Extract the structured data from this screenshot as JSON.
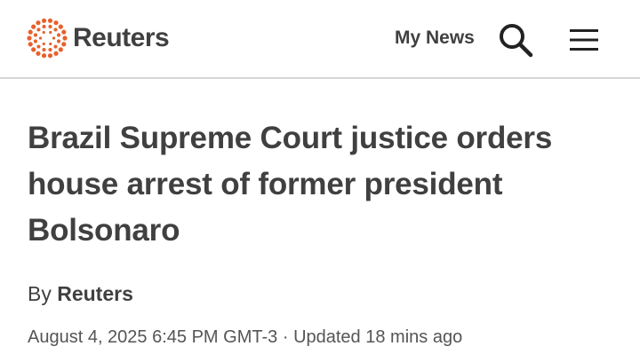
{
  "colors": {
    "brand_orange": "#e8602c",
    "text": "#404040",
    "divider": "#d6d6d6"
  },
  "header": {
    "logo_icon": "reuters-dots-logo-icon",
    "logo_text": "Reuters",
    "my_news_label": "My News",
    "search_icon": "search-icon",
    "menu_icon": "hamburger-menu-icon"
  },
  "article": {
    "headline": "Brazil Supreme Court justice orders house arrest of former president Bolsonaro",
    "byline_prefix": "By",
    "author": "Reuters",
    "published": "August 4, 2025 6:45 PM GMT-3",
    "separator": "·",
    "updated": "Updated 18 mins ago"
  }
}
